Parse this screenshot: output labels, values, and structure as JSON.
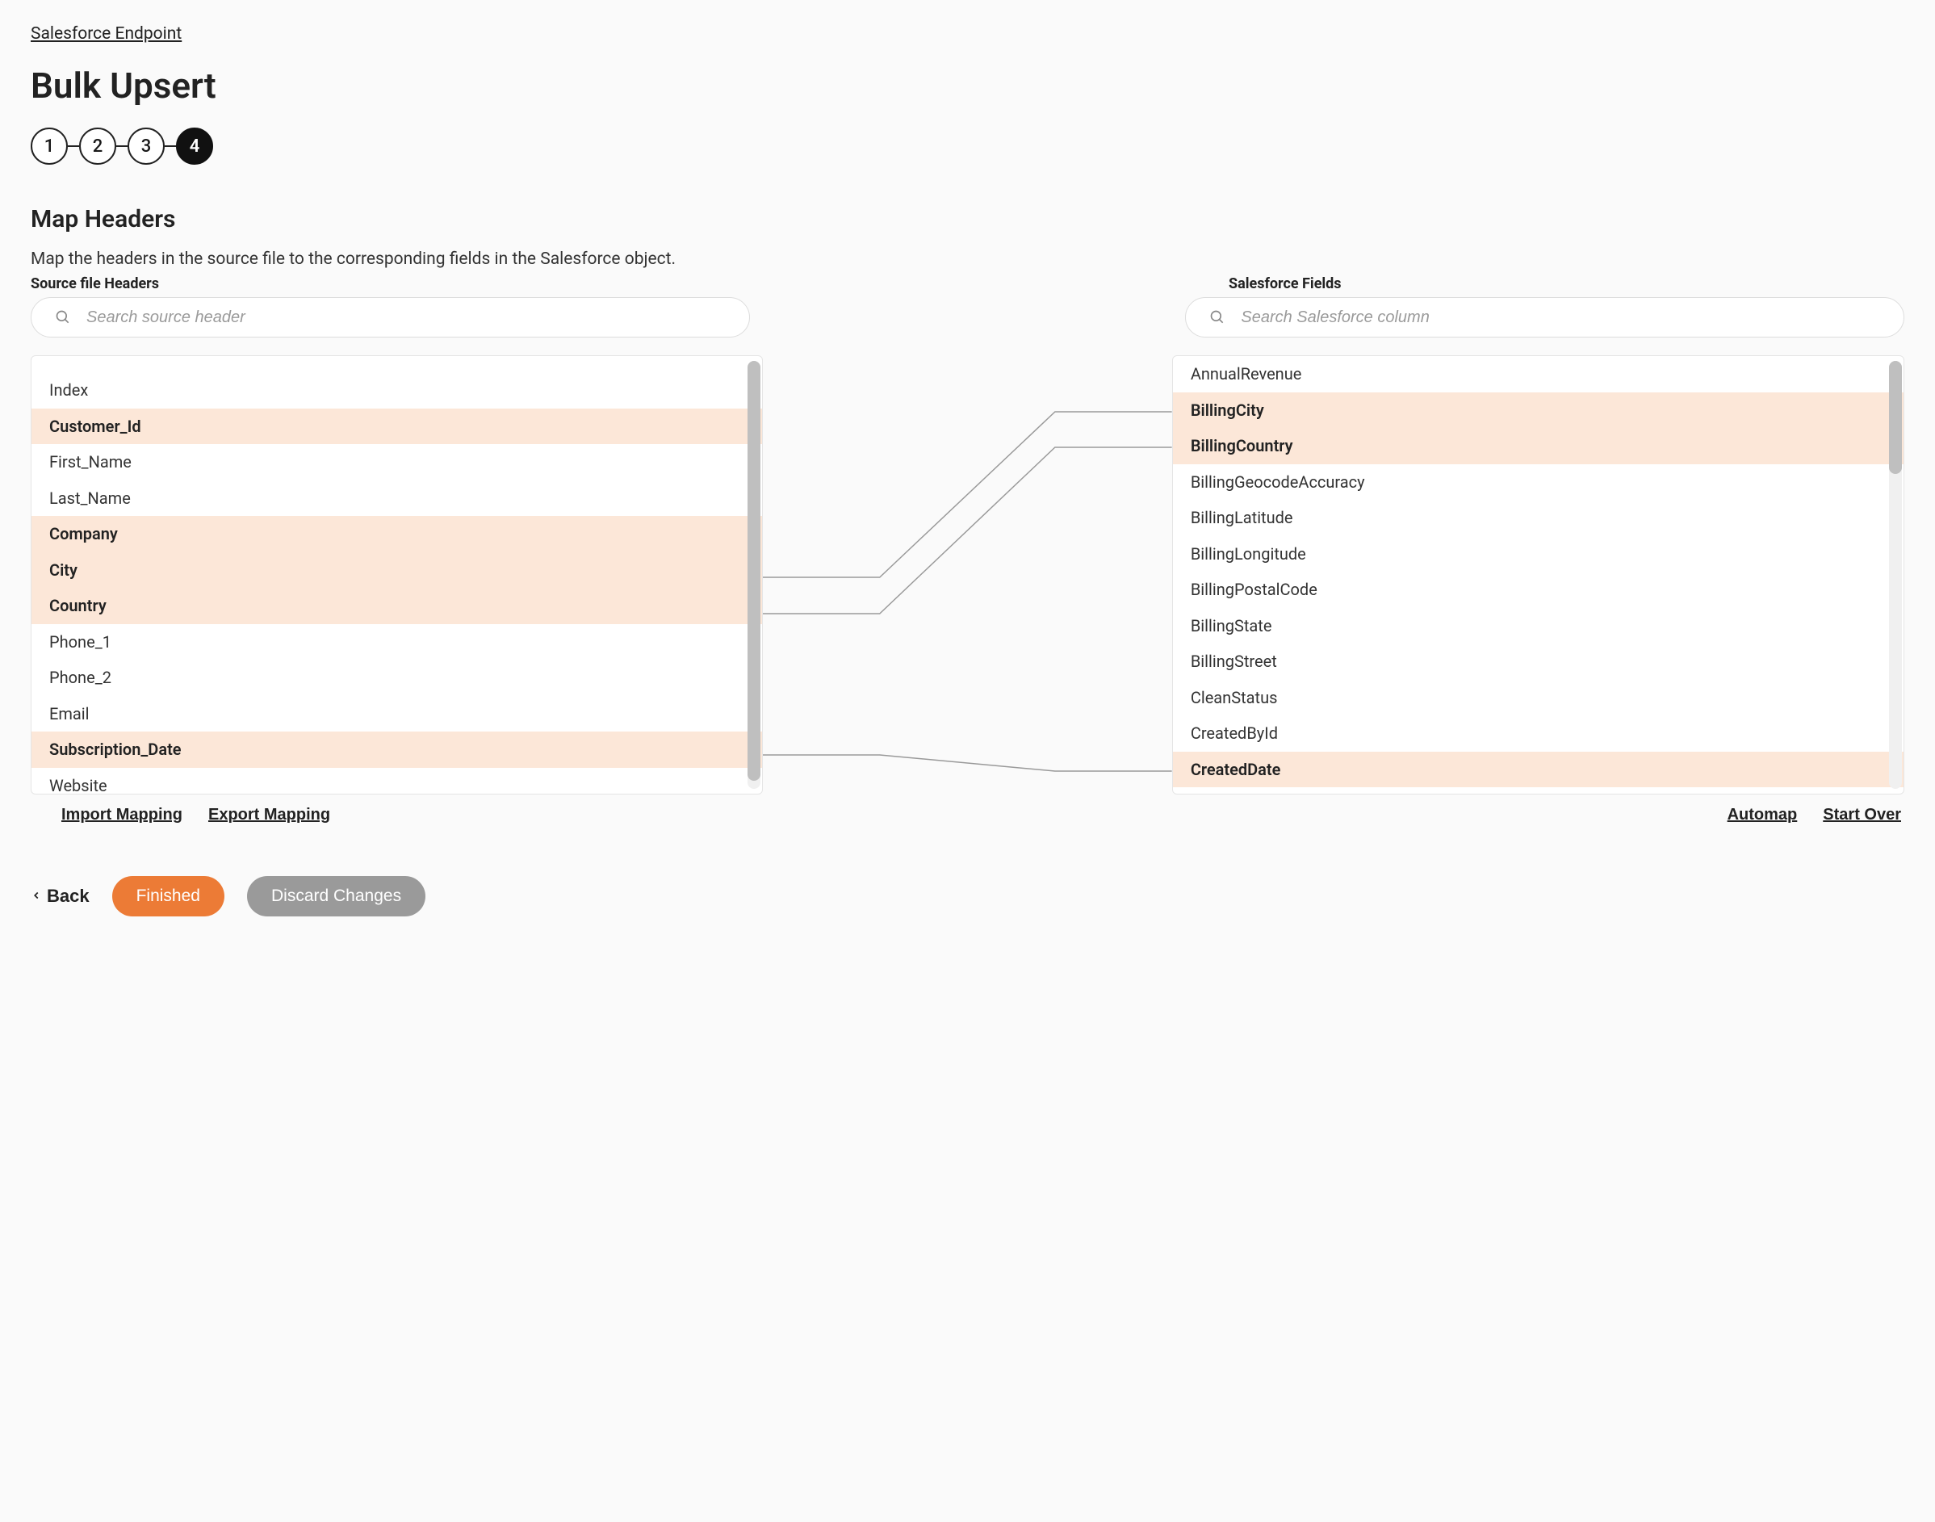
{
  "breadcrumb": "Salesforce Endpoint",
  "page_title": "Bulk Upsert",
  "stepper": {
    "steps": [
      "1",
      "2",
      "3",
      "4"
    ],
    "active_index": 3
  },
  "section": {
    "title": "Map Headers",
    "description": "Map the headers in the source file to the corresponding fields in the Salesforce object."
  },
  "left": {
    "label": "Source file Headers",
    "search_placeholder": "Search source header",
    "rows": [
      {
        "label": "Index",
        "mapped": false
      },
      {
        "label": "Customer_Id",
        "mapped": true
      },
      {
        "label": "First_Name",
        "mapped": false
      },
      {
        "label": "Last_Name",
        "mapped": false
      },
      {
        "label": "Company",
        "mapped": true
      },
      {
        "label": "City",
        "mapped": true
      },
      {
        "label": "Country",
        "mapped": true
      },
      {
        "label": "Phone_1",
        "mapped": false
      },
      {
        "label": "Phone_2",
        "mapped": false
      },
      {
        "label": "Email",
        "mapped": false
      },
      {
        "label": "Subscription_Date",
        "mapped": true
      },
      {
        "label": "Website",
        "mapped": false
      }
    ]
  },
  "right": {
    "label": "Salesforce Fields",
    "search_placeholder": "Search Salesforce column",
    "rows": [
      {
        "label": "AnnualRevenue",
        "mapped": false
      },
      {
        "label": "BillingCity",
        "mapped": true
      },
      {
        "label": "BillingCountry",
        "mapped": true
      },
      {
        "label": "BillingGeocodeAccuracy",
        "mapped": false
      },
      {
        "label": "BillingLatitude",
        "mapped": false
      },
      {
        "label": "BillingLongitude",
        "mapped": false
      },
      {
        "label": "BillingPostalCode",
        "mapped": false
      },
      {
        "label": "BillingState",
        "mapped": false
      },
      {
        "label": "BillingStreet",
        "mapped": false
      },
      {
        "label": "CleanStatus",
        "mapped": false
      },
      {
        "label": "CreatedById",
        "mapped": false
      },
      {
        "label": "CreatedDate",
        "mapped": true
      }
    ]
  },
  "toolbar": {
    "import_label": "Import Mapping",
    "export_label": "Export Mapping",
    "automap_label": "Automap",
    "startover_label": "Start Over"
  },
  "footer": {
    "back_label": "Back",
    "finished_label": "Finished",
    "discard_label": "Discard Changes"
  }
}
